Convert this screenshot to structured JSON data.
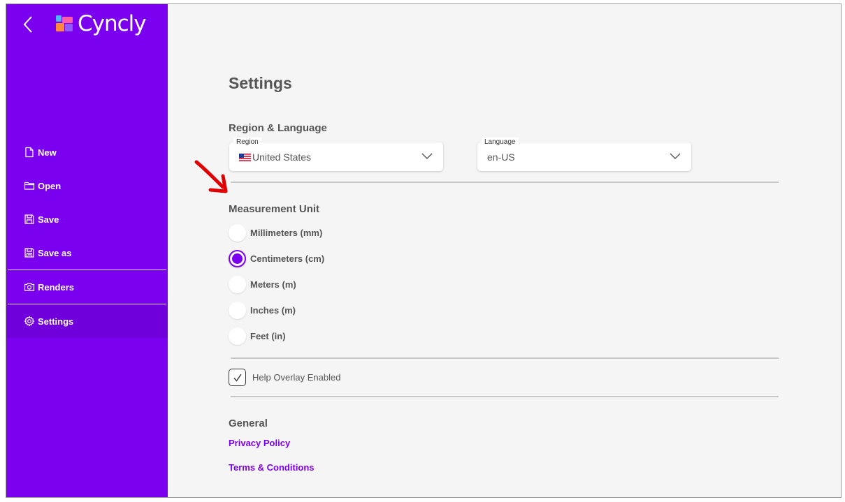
{
  "app": {
    "logo_text": "Cyncly"
  },
  "sidebar": {
    "items": [
      {
        "label": "New",
        "icon": "file-icon"
      },
      {
        "label": "Open",
        "icon": "folder-icon"
      },
      {
        "label": "Save",
        "icon": "save-icon"
      },
      {
        "label": "Save as",
        "icon": "save-as-icon"
      },
      {
        "label": "Renders",
        "icon": "camera-icon"
      },
      {
        "label": "Settings",
        "icon": "gear-icon",
        "active": true
      }
    ]
  },
  "settings": {
    "title": "Settings",
    "region_language": {
      "title": "Region & Language",
      "region": {
        "label": "Region",
        "value": "United States",
        "flag": "us-flag-icon"
      },
      "language": {
        "label": "Language",
        "value": "en-US"
      }
    },
    "measurement": {
      "title": "Measurement Unit",
      "options": [
        {
          "label": "Millimeters (mm)",
          "checked": false
        },
        {
          "label": "Centimeters (cm)",
          "checked": true
        },
        {
          "label": "Meters (m)",
          "checked": false
        },
        {
          "label": "Inches (m)",
          "checked": false
        },
        {
          "label": "Feet (in)",
          "checked": false
        }
      ]
    },
    "help_overlay": {
      "label": "Help Overlay Enabled",
      "checked": true
    },
    "general": {
      "title": "General",
      "links": [
        "Privacy Policy",
        "Terms & Conditions"
      ]
    }
  },
  "colors": {
    "accent": "#7b00f0",
    "annotation": "#e00000",
    "background": "#f5f5f5"
  }
}
